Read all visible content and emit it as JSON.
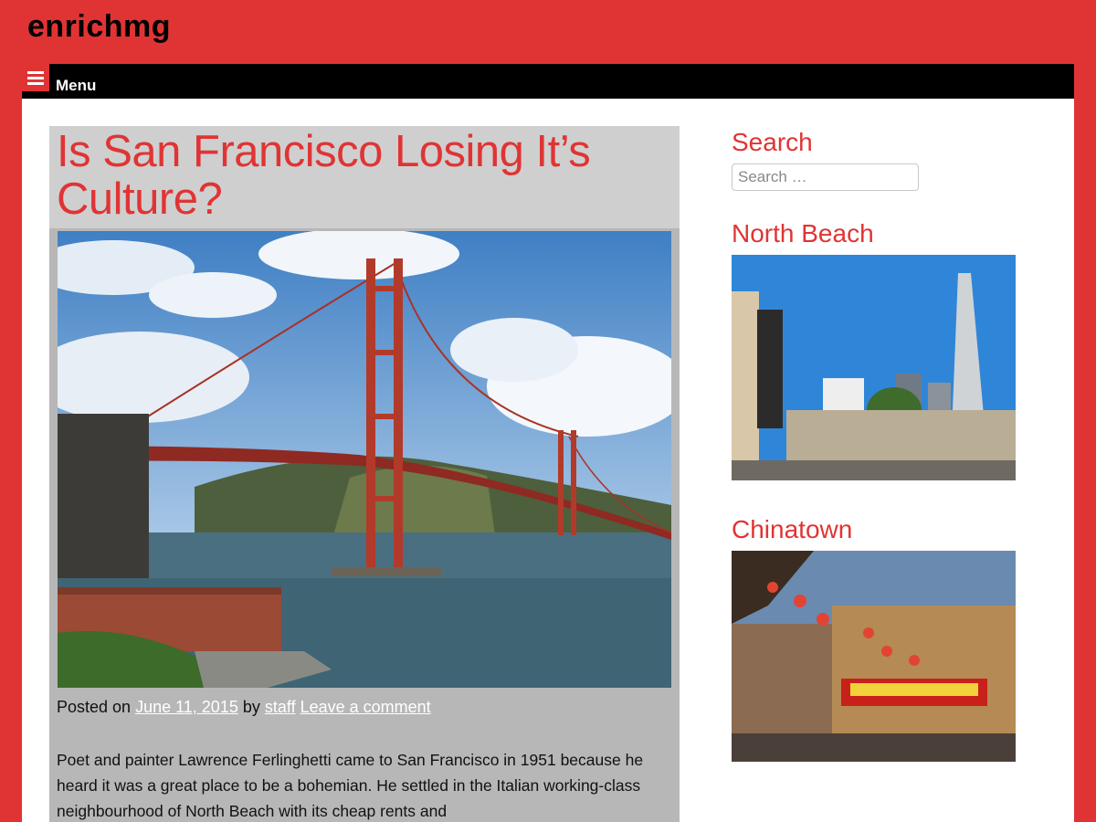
{
  "site": {
    "title": "enrichmg"
  },
  "nav": {
    "menu_label": "Menu"
  },
  "post": {
    "title": "Is San Francisco Losing It’s Culture?",
    "meta": {
      "posted_on_label": "Posted on",
      "date": "June 11, 2015",
      "by_label": "by",
      "author": "staff",
      "comment_link": "Leave a comment"
    },
    "excerpt": "Poet and painter Lawrence Ferlinghetti came to San Francisco in 1951 because he heard it was a great place to be a bohemian. He settled in the Italian working-class neighbourhood of North Beach with its cheap rents and"
  },
  "sidebar": {
    "search": {
      "title": "Search",
      "placeholder": "Search …"
    },
    "north_beach": {
      "title": "North Beach"
    },
    "chinatown": {
      "title": "Chinatown"
    }
  },
  "colors": {
    "accent": "#e03434",
    "nav_bg": "#000000",
    "article_bg": "#b7b7b7"
  }
}
